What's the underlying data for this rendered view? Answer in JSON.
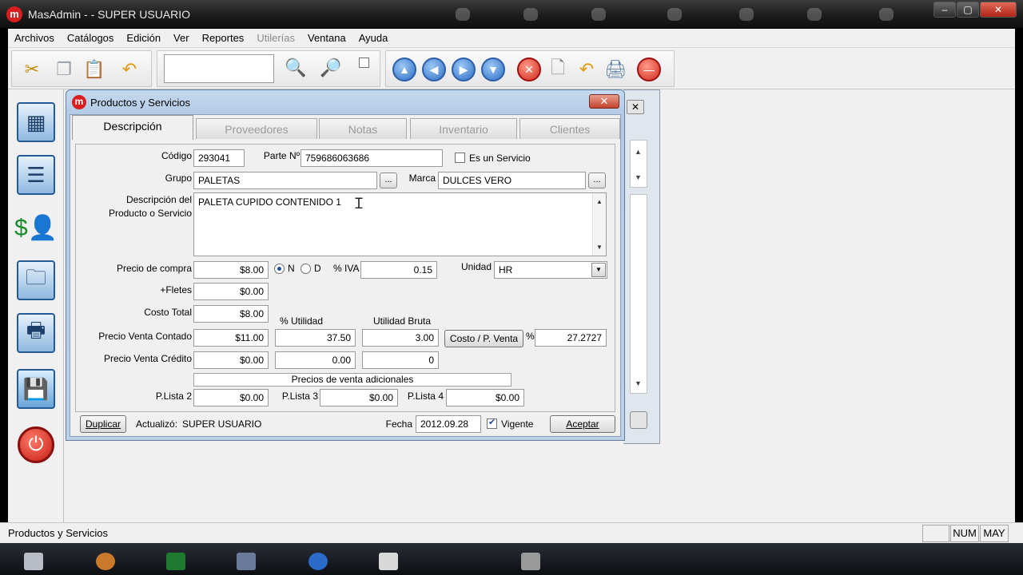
{
  "app": {
    "title": "MasAdmin -  - SUPER USUARIO",
    "logo_letter": "m"
  },
  "menu": [
    "Archivos",
    "Catálogos",
    "Edición",
    "Ver",
    "Reportes",
    "Utilerías",
    "Ventana",
    "Ayuda"
  ],
  "menu_disabled": [
    "Utilerías"
  ],
  "toolbar": {
    "icons": [
      "cut-icon",
      "copy-icon",
      "paste-icon",
      "undo-icon",
      "search-icon",
      "search-web-icon",
      "checkbox",
      "first-icon",
      "prev-icon",
      "next-icon",
      "last-icon",
      "delete-icon",
      "new-icon",
      "undo-icon",
      "print-preview-icon",
      "stop-icon"
    ],
    "search_value": ""
  },
  "sidebar": [
    "calculator-icon",
    "customer-card-icon",
    "money-user-icon",
    "printer-folder-icon",
    "printer-icon",
    "save-disk-icon",
    "power-icon"
  ],
  "dialog": {
    "title": "Productos y Servicios",
    "close_label": "✕",
    "tabs": [
      "Descripción",
      "Proveedores",
      "Notas",
      "Inventario",
      "Clientes"
    ],
    "active_tab": "Descripción",
    "labels": {
      "codigo": "Código",
      "parte": "Parte Nº",
      "es_servicio": "Es un Servicio",
      "grupo": "Grupo",
      "marca": "Marca",
      "descripcion_1": "Descripción del",
      "descripcion_2": "Producto o Servicio",
      "precio_compra": "Precio de compra",
      "radio_n": "N",
      "radio_d": "D",
      "iva": "% IVA",
      "unidad": "Unidad",
      "fletes": "+Fletes",
      "costo_total": "Costo Total",
      "utilidad_pct": "% Utilidad",
      "utilidad_bruta": "Utilidad Bruta",
      "precio_contado": "Precio Venta Contado",
      "precio_credito": "Precio Venta Crédito",
      "pct_symbol": "%",
      "precios_adicionales": "Precios de venta adicionales",
      "plista2": "P.Lista 2",
      "plista3": "P.Lista 3",
      "plista4": "P.Lista 4",
      "actualizo": "Actualizó:",
      "fecha": "Fecha",
      "vigente": "Vigente"
    },
    "values": {
      "codigo": "293041",
      "parte": "759686063686",
      "es_servicio": false,
      "grupo": "PALETAS",
      "marca": "DULCES VERO",
      "descripcion": "PALETA CUPIDO CONTENIDO 1",
      "precio_compra": "$8.00",
      "radio_selected": "N",
      "iva": "0.15",
      "unidad": "HR",
      "fletes": "$0.00",
      "costo_total": "$8.00",
      "precio_contado": "$11.00",
      "utilidad_pct_contado": "37.50",
      "utilidad_bruta_contado": "3.00",
      "costo_pventa_pct": "27.2727",
      "precio_credito": "$0.00",
      "utilidad_pct_credito": "0.00",
      "utilidad_bruta_credito": "0",
      "plista2": "$0.00",
      "plista3": "$0.00",
      "plista4": "$0.00",
      "actualizo_user": "SUPER USUARIO",
      "fecha": "2012.09.28",
      "vigente": true
    },
    "buttons": {
      "ellipsis": "...",
      "costo_pventa": "Costo / P. Venta",
      "duplicar": "Duplicar",
      "aceptar": "Aceptar"
    }
  },
  "statusbar": {
    "text": "Productos y Servicios",
    "num": "NUM",
    "may": "MAY"
  },
  "colors": {
    "dialog_frame": "#bcd0e6",
    "brand_red": "#d81e1e",
    "taskbar": "#0c0e12"
  }
}
